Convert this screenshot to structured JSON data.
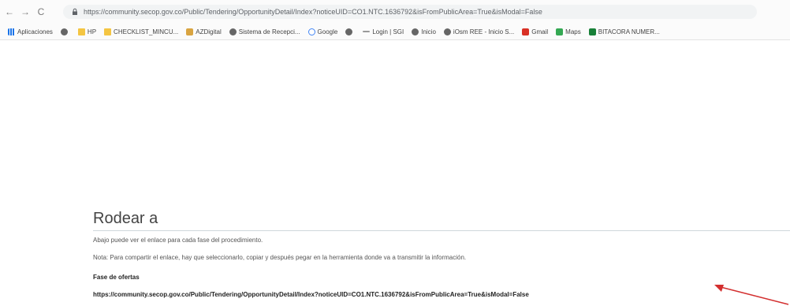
{
  "browser": {
    "nav": {
      "back": "←",
      "forward": "→",
      "reload": "C"
    },
    "url": "https://community.secop.gov.co/Public/Tendering/OpportunityDetail/Index?noticeUID=CO1.NTC.1636792&isFromPublicArea=True&isModal=False",
    "bookmarks": [
      {
        "label": "Aplicaciones",
        "icon": "apps-icon"
      },
      {
        "label": "",
        "icon": "globe-icon"
      },
      {
        "label": "HP",
        "icon": "folder-icon"
      },
      {
        "label": "CHECKLIST_MINCU...",
        "icon": "folder-icon"
      },
      {
        "label": "AZDigital",
        "icon": "star-icon"
      },
      {
        "label": "Sistema de Recepci...",
        "icon": "globe-icon"
      },
      {
        "label": "Google",
        "icon": "google-icon"
      },
      {
        "label": "",
        "icon": "globe-icon"
      },
      {
        "label": "Login | SGI",
        "icon": "dash-icon"
      },
      {
        "label": "Inicio",
        "icon": "globe-icon"
      },
      {
        "label": "iOsm REE - Inicio S...",
        "icon": "globe-icon"
      },
      {
        "label": "Gmail",
        "icon": "gmail-icon"
      },
      {
        "label": "Maps",
        "icon": "maps-icon"
      },
      {
        "label": "BITACORA NUMER...",
        "icon": "sheet-icon"
      }
    ]
  },
  "page": {
    "heading": "Rodear a",
    "intro": "Abajo puede ver el enlace para cada fase del procedimiento.",
    "note": "Nota: Para compartir el enlace, hay que seleccionarlo, copiar y después pegar en la herramienta donde va a transmitir la información.",
    "phase_title": "Fase de ofertas",
    "phase_link": "https://community.secop.gov.co/Public/Tendering/OpportunityDetail/Index?noticeUID=CO1.NTC.1636792&isFromPublicArea=True&isModal=False"
  },
  "colors": {
    "arrow": "#d32f2f",
    "rule": "#cfd8dc"
  }
}
